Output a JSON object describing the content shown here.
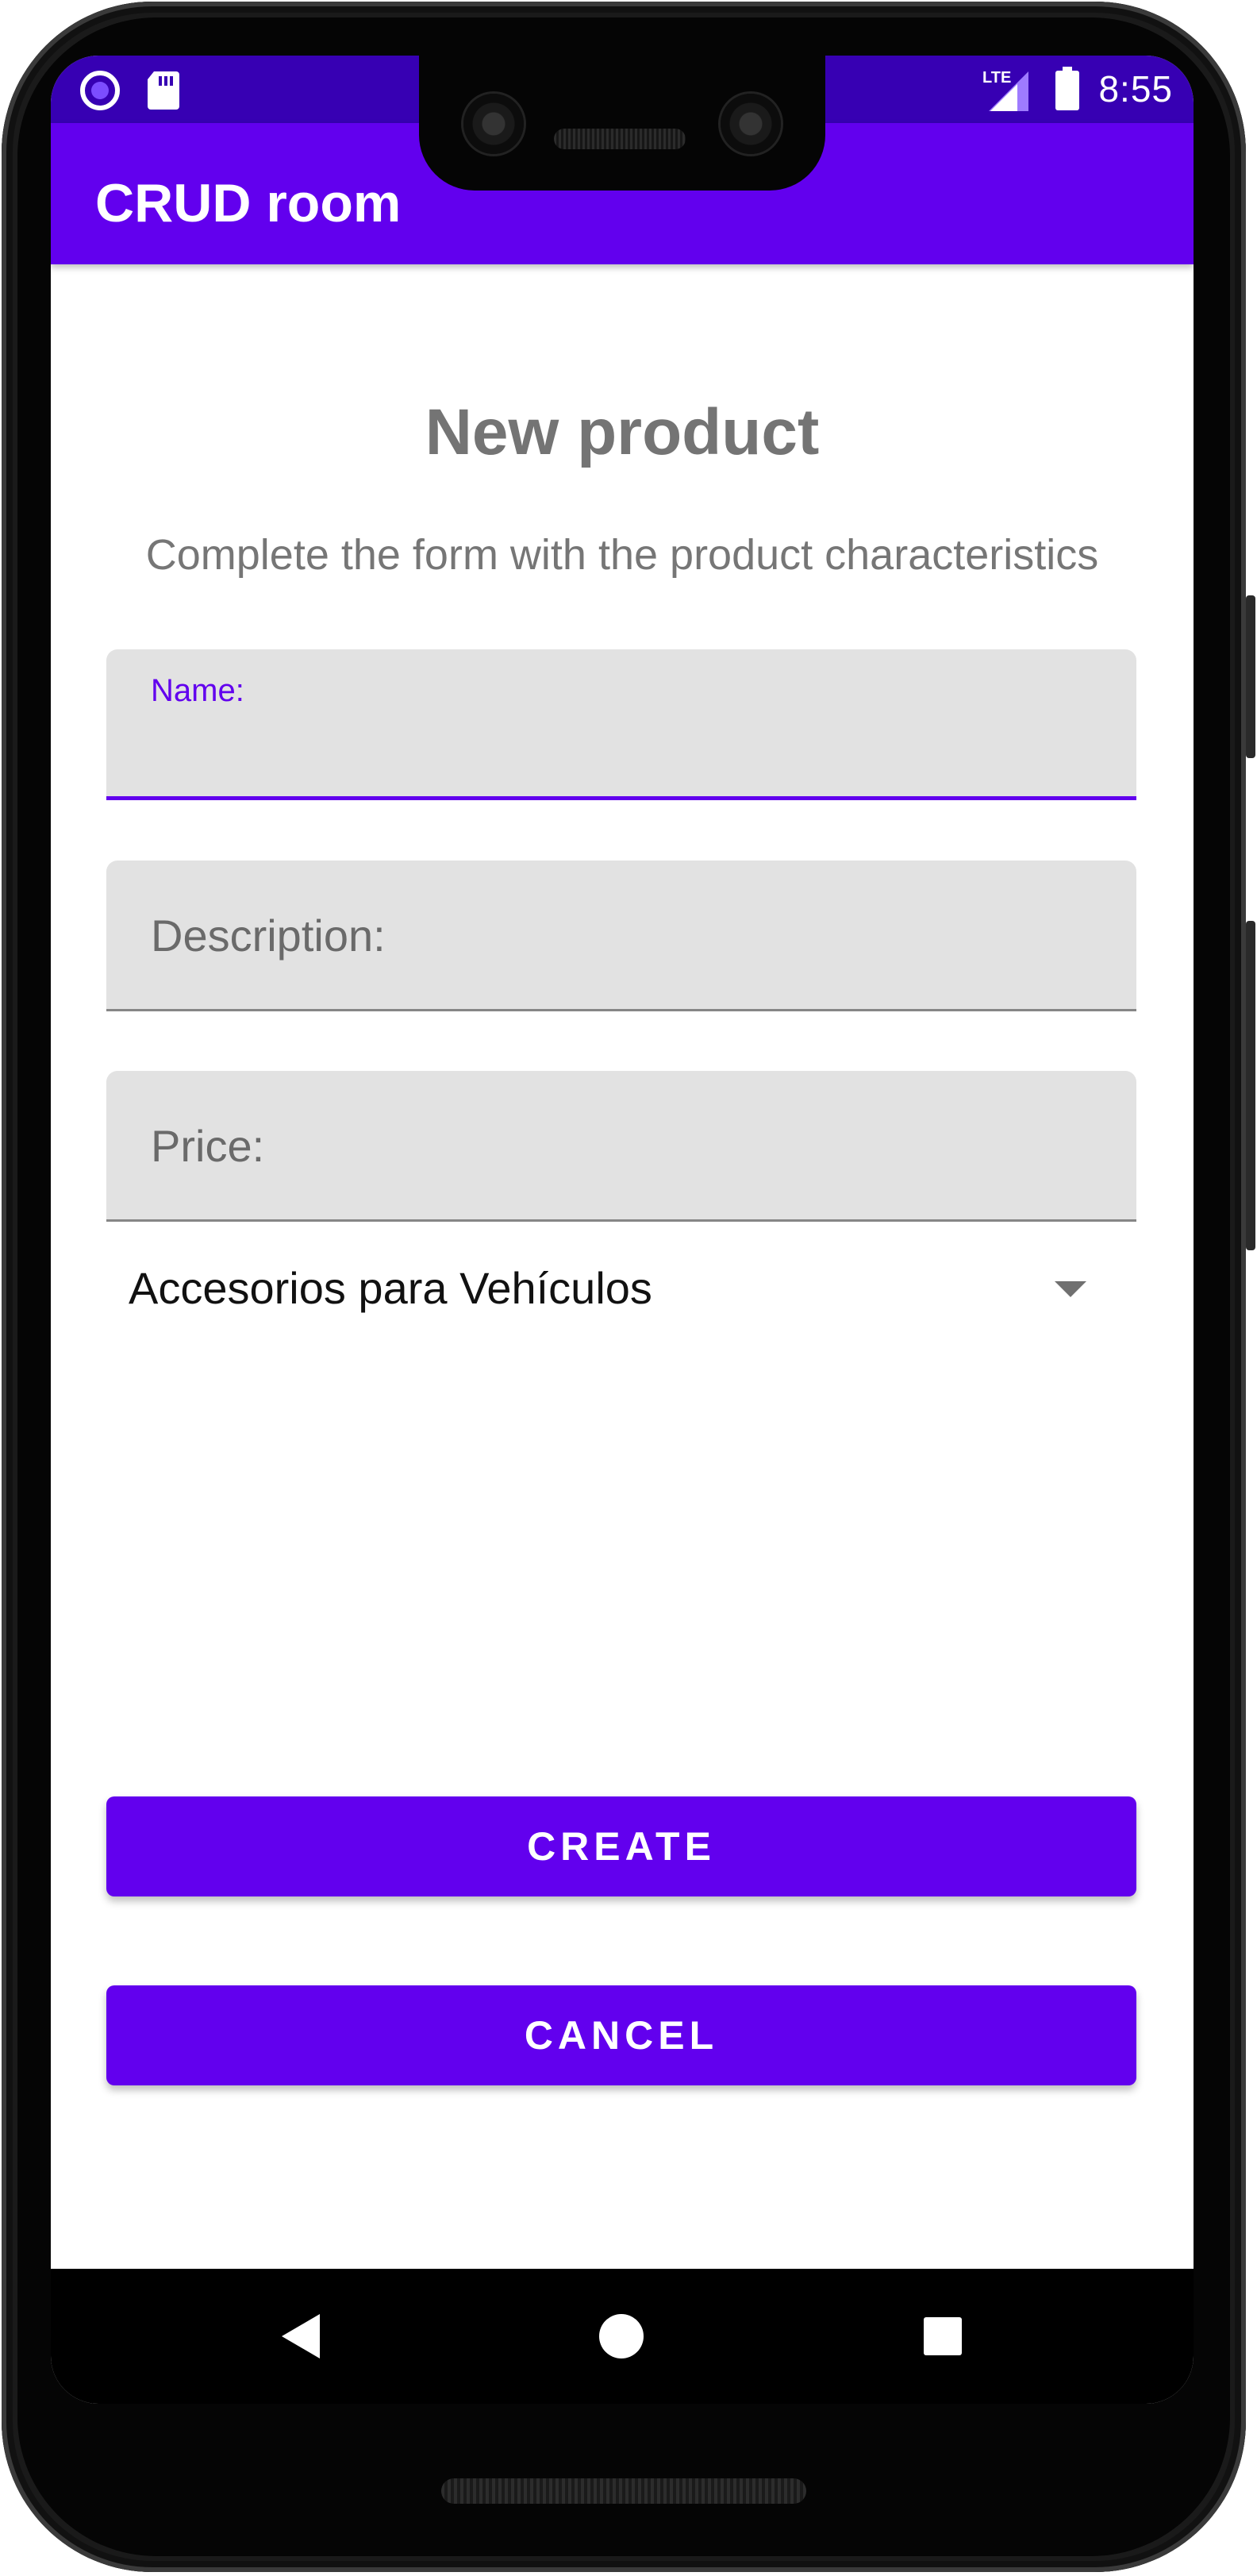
{
  "status_bar": {
    "time": "8:55",
    "network": "LTE",
    "icons": [
      "cast-icon",
      "sd-card-icon",
      "lte-signal-icon",
      "battery-icon"
    ]
  },
  "app_bar": {
    "title": "CRUD room"
  },
  "form": {
    "title": "New product",
    "subtitle": "Complete the form with the product characteristics",
    "name_label": "Name:",
    "name_value": "",
    "description_label": "Description:",
    "price_label": "Price:",
    "category_selected": "Accesorios para Vehículos"
  },
  "actions": {
    "create_label": "CREATE",
    "cancel_label": "CANCEL"
  },
  "navigation": {
    "icons": [
      "back-icon",
      "home-icon",
      "recents-icon"
    ]
  },
  "colors": {
    "primary": "#6200ee",
    "primary_dark": "#3700b3",
    "text_gray": "#747474",
    "field_bg": "#e2e2e2"
  }
}
